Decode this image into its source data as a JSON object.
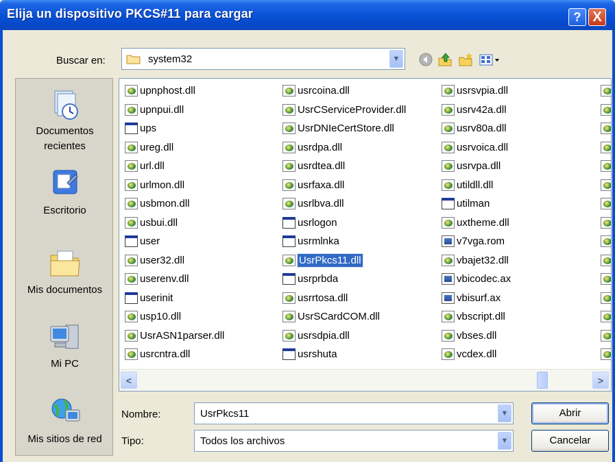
{
  "window": {
    "title": "Elija un dispositivo PKCS#11 para cargar",
    "help_label": "?",
    "close_label": "X"
  },
  "lookin": {
    "label": "Buscar en:",
    "value": "system32"
  },
  "toolbar": {
    "icons": [
      "back-icon",
      "up-folder-icon",
      "new-folder-icon",
      "view-menu-icon"
    ]
  },
  "places": [
    {
      "label_1": "Documentos",
      "label_2": "recientes",
      "icon": "recent-documents-icon"
    },
    {
      "label_1": "Escritorio",
      "icon": "desktop-icon"
    },
    {
      "label_1": "Mis documentos",
      "icon": "my-documents-icon"
    },
    {
      "label_1": "Mi PC",
      "icon": "my-computer-icon"
    },
    {
      "label_1": "Mis sitios de red",
      "icon": "network-places-icon"
    }
  ],
  "files": {
    "col1": [
      "upnphost.dll",
      "upnpui.dll",
      "ups",
      "ureg.dll",
      "url.dll",
      "urlmon.dll",
      "usbmon.dll",
      "usbui.dll",
      "user",
      "user32.dll",
      "userenv.dll",
      "userinit",
      "usp10.dll",
      "UsrASN1parser.dll",
      "usrcntra.dll"
    ],
    "col2": [
      "usrcoina.dll",
      "UsrCServiceProvider.dll",
      "UsrDNIeCertStore.dll",
      "usrdpa.dll",
      "usrdtea.dll",
      "usrfaxa.dll",
      "usrlbva.dll",
      "usrlogon",
      "usrmlnka",
      "UsrPkcs11.dll",
      "usrprbda",
      "usrrtosa.dll",
      "UsrSCardCOM.dll",
      "usrsdpia.dll",
      "usrshuta"
    ],
    "col3": [
      "usrsvpia.dll",
      "usrv42a.dll",
      "usrv80a.dll",
      "usrvoica.dll",
      "usrvpa.dll",
      "utildll.dll",
      "utilman",
      "uxtheme.dll",
      "v7vga.rom",
      "vbajet32.dll",
      "vbicodec.ax",
      "vbisurf.ax",
      "vbscript.dll",
      "vbses.dll",
      "vcdex.dll"
    ],
    "selected": "UsrPkcs11.dll"
  },
  "scrollbar": {
    "left_label": "<",
    "right_label": ">"
  },
  "name_field": {
    "label": "Nombre:",
    "value": "UsrPkcs11"
  },
  "type_field": {
    "label": "Tipo:",
    "value": "Todos los archivos"
  },
  "buttons": {
    "open": "Abrir",
    "cancel": "Cancelar"
  }
}
